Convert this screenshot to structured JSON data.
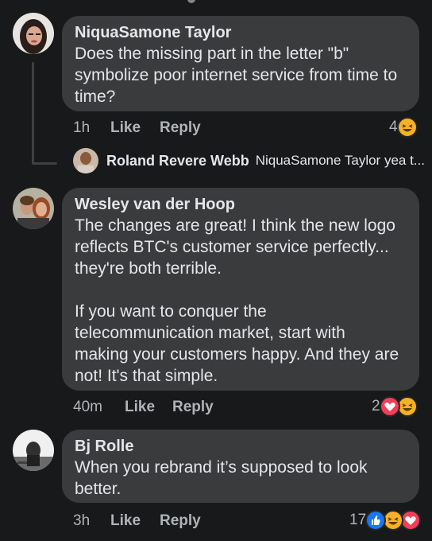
{
  "comments": [
    {
      "author": "NiquaSamone Taylor",
      "text": "Does the missing part in the letter \"b\"\nsymbolize poor internet service from time to\ntime?",
      "time": "1h",
      "like": "Like",
      "reply": "Reply",
      "reaction_count": "4",
      "reactions": [
        "haha-icon"
      ]
    },
    {
      "author": "Wesley van der Hoop",
      "text": "The changes are great! I think the new logo\nreflects BTC's customer service perfectly...\nthey're both terrible.\n\nIf you want to conquer the\ntelecommunication market, start with\nmaking your customers happy. And they are\nnot! It's that simple.",
      "time": "40m",
      "like": "Like",
      "reply": "Reply",
      "reaction_count": "2",
      "reactions": [
        "love-icon",
        "haha-icon"
      ]
    },
    {
      "author": "Bj Rolle",
      "text": "When you rebrand it’s supposed to look\nbetter.",
      "time": "3h",
      "like": "Like",
      "reply": "Reply",
      "reaction_count": "17",
      "reactions": [
        "like-icon",
        "haha-icon",
        "love-icon"
      ]
    }
  ],
  "reply_preview": {
    "author": "Roland Revere Webb",
    "text": "NiquaSamone Taylor yea t..."
  },
  "colors": {
    "background": "#18191a",
    "bubble": "#3a3b3c",
    "like_blue": "#1877f2",
    "love_red": "#f33e58",
    "haha_yellow": "#f7b125"
  }
}
